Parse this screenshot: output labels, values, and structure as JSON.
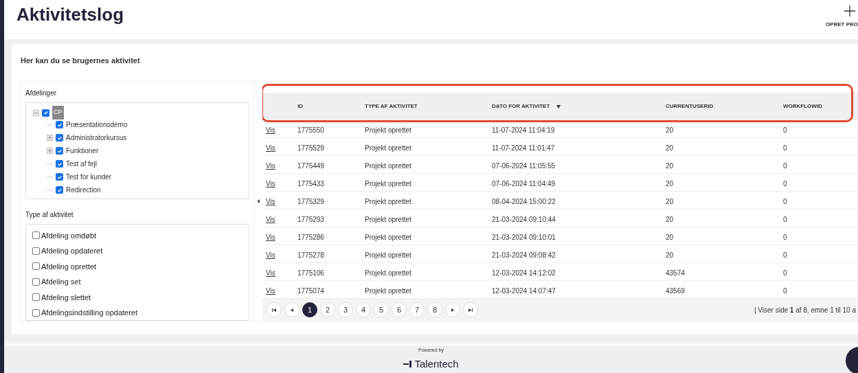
{
  "page": {
    "title": "Aktivitetslog",
    "create_button": "OPRET PRO",
    "subtitle": "Her kan du se brugernes aktivitet"
  },
  "departments": {
    "label": "Afdelinger",
    "tree": [
      {
        "label": "CP",
        "checked": true,
        "expanded": true,
        "children": [
          {
            "label": "Præsentationsdemo",
            "checked": true,
            "expandable": false
          },
          {
            "label": "Administratorkursus",
            "checked": true,
            "expandable": true
          },
          {
            "label": "Funktioner",
            "checked": true,
            "expandable": true
          },
          {
            "label": "Test af fejl",
            "checked": true,
            "expandable": false
          },
          {
            "label": "Test for kunder",
            "checked": true,
            "expandable": false
          },
          {
            "label": "Redirection",
            "checked": true,
            "expandable": false
          }
        ]
      }
    ]
  },
  "activity_types": {
    "label": "Type af aktivitet",
    "items": [
      {
        "label": "Afdeling omdøbt",
        "checked": false
      },
      {
        "label": "Afdeling opdateret",
        "checked": false
      },
      {
        "label": "Afdeling oprettet",
        "checked": false
      },
      {
        "label": "Afdeling set",
        "checked": false
      },
      {
        "label": "Afdeling slettet",
        "checked": false
      },
      {
        "label": "Afdelingsindstilling opdateret",
        "checked": false
      }
    ]
  },
  "table": {
    "columns": [
      {
        "label": "ID",
        "sorted": false
      },
      {
        "label": "TYPE AF AKTIVITET",
        "sorted": false
      },
      {
        "label": "DATO FOR AKTIVITET",
        "sorted": true
      },
      {
        "label": "CURRENTUSERID",
        "sorted": false
      },
      {
        "label": "WORKFLOWID",
        "sorted": false
      }
    ],
    "rows": [
      {
        "link": "Vis",
        "cells": [
          "1775550",
          "Projekt oprettet",
          "11-07-2024 11:04:19",
          "20",
          "0"
        ]
      },
      {
        "link": "Vis",
        "cells": [
          "1775529",
          "Projekt oprettet",
          "11-07-2024 11:01:47",
          "20",
          "0"
        ]
      },
      {
        "link": "Vis",
        "cells": [
          "1775449",
          "Projekt oprettet",
          "07-06-2024 11:05:55",
          "20",
          "0"
        ]
      },
      {
        "link": "Vis",
        "cells": [
          "1775433",
          "Projekt oprettet",
          "07-06-2024 11:04:49",
          "20",
          "0"
        ]
      },
      {
        "link": "Vis",
        "cells": [
          "1775329",
          "Projekt oprettet",
          "08-04-2024 15:00:22",
          "20",
          "0"
        ]
      },
      {
        "link": "Vis",
        "cells": [
          "1775293",
          "Projekt oprettet",
          "21-03-2024 09:10:44",
          "20",
          "0"
        ]
      },
      {
        "link": "Vis",
        "cells": [
          "1775286",
          "Projekt oprettet",
          "21-03-2024 09:10:01",
          "20",
          "0"
        ]
      },
      {
        "link": "Vis",
        "cells": [
          "1775278",
          "Projekt oprettet",
          "21-03-2024 09:08:42",
          "20",
          "0"
        ]
      },
      {
        "link": "Vis",
        "cells": [
          "1775106",
          "Projekt oprettet",
          "12-03-2024 14:12:02",
          "43574",
          "0"
        ]
      },
      {
        "link": "Vis",
        "cells": [
          "1775074",
          "Projekt oprettet",
          "12-03-2024 14:07:47",
          "43569",
          "0"
        ]
      }
    ],
    "pages": [
      {
        "label": "1",
        "selected": true
      },
      {
        "label": "2",
        "selected": false
      },
      {
        "label": "3",
        "selected": false
      },
      {
        "label": "4",
        "selected": false
      },
      {
        "label": "5",
        "selected": false
      },
      {
        "label": "6",
        "selected": false
      },
      {
        "label": "7",
        "selected": false
      },
      {
        "label": "8",
        "selected": false
      }
    ],
    "page_info": "| Viser side **1** af 8, emne 1 til 10 a"
  },
  "footer": {
    "powered_by": "Powered by",
    "brand": "Talentech"
  }
}
